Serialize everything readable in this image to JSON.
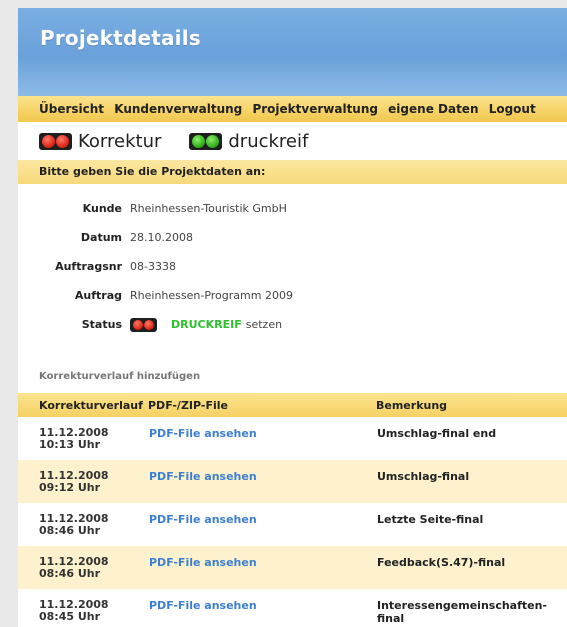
{
  "header": {
    "title": "Projektdetails"
  },
  "nav": {
    "items": [
      "Übersicht",
      "Kundenverwaltung",
      "Projektverwaltung",
      "eigene Daten",
      "Logout"
    ]
  },
  "legend": {
    "korrektur_label": "Korrektur",
    "druckreif_label": "druckreif"
  },
  "form": {
    "section_title": "Bitte geben Sie die Projektdaten an:",
    "fields": [
      {
        "label": "Kunde",
        "value": "Rheinhessen-Touristik GmbH"
      },
      {
        "label": "Datum",
        "value": "28.10.2008"
      },
      {
        "label": "Auftragsnr",
        "value": "08-3338"
      },
      {
        "label": "Auftrag",
        "value": "Rheinhessen-Programm 2009"
      }
    ],
    "status_label": "Status",
    "status_action": "DRUCKREIF",
    "status_suffix": "setzen"
  },
  "add_link": "Korrekturverlauf hinzufügen",
  "table": {
    "headers": [
      "Korrekturverlauf",
      "PDF-/ZIP-File",
      "Bemerkung"
    ],
    "rows": [
      {
        "date": "11.12.2008",
        "time": "10:13 Uhr",
        "link": "PDF-File ansehen",
        "note": "Umschlag-final end"
      },
      {
        "date": "11.12.2008",
        "time": "09:12 Uhr",
        "link": "PDF-File ansehen",
        "note": "Umschlag-final"
      },
      {
        "date": "11.12.2008",
        "time": "08:46 Uhr",
        "link": "PDF-File ansehen",
        "note": "Letzte Seite-final"
      },
      {
        "date": "11.12.2008",
        "time": "08:46 Uhr",
        "link": "PDF-File ansehen",
        "note": "Feedback(S.47)-final"
      },
      {
        "date": "11.12.2008",
        "time": "08:45 Uhr",
        "link": "PDF-File ansehen",
        "note": "Interessengemeinschaften-final"
      }
    ]
  },
  "colors": {
    "header_blue": "#6aa1da",
    "nav_yellow": "#f6d264",
    "link_blue": "#3d7fd2",
    "status_green": "#2cc02c",
    "row_alt": "#fdf2cd"
  }
}
